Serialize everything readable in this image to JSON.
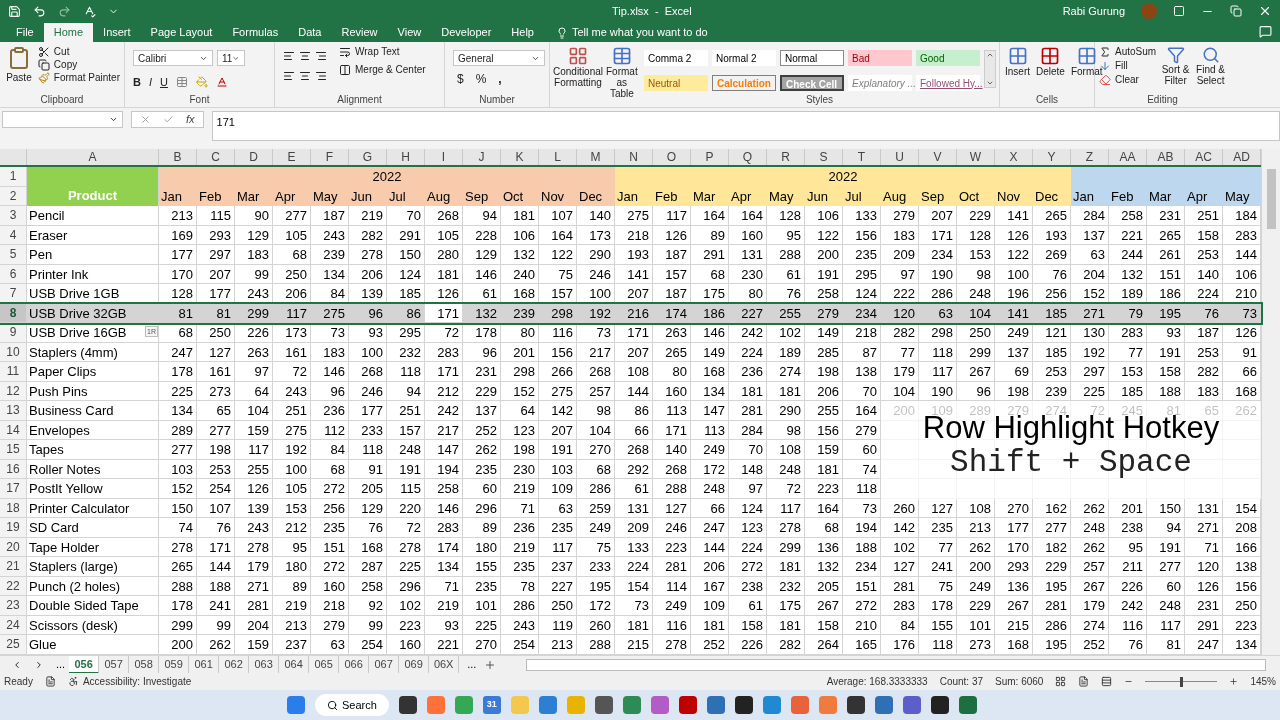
{
  "title_bar": {
    "file_title": "Tip.xlsx  -  Excel",
    "user": "Rabi Gurung"
  },
  "ribbon_tabs": [
    {
      "label": "File",
      "selected": false
    },
    {
      "label": "Home",
      "selected": true
    },
    {
      "label": "Insert",
      "selected": false
    },
    {
      "label": "Page Layout",
      "selected": false
    },
    {
      "label": "Formulas",
      "selected": false
    },
    {
      "label": "Data",
      "selected": false
    },
    {
      "label": "Review",
      "selected": false
    },
    {
      "label": "View",
      "selected": false
    },
    {
      "label": "Developer",
      "selected": false
    },
    {
      "label": "Help",
      "selected": false
    }
  ],
  "tell_me": "Tell me what you want to do",
  "ribbon": {
    "clipboard": {
      "label": "Clipboard",
      "paste": "Paste",
      "cut": "Cut",
      "copy": "Copy",
      "format_painter": "Format Painter"
    },
    "font": {
      "label": "Font",
      "name": "Calibri",
      "size": "11",
      "bold": "B",
      "italic": "I",
      "underline": "U"
    },
    "alignment": {
      "label": "Alignment",
      "wrap": "Wrap Text",
      "merge": "Merge & Center"
    },
    "number": {
      "label": "Number",
      "format": "General",
      "currency": "$",
      "percent": "%",
      "comma": ","
    },
    "conditional_formatting": "Conditional Formatting",
    "format_as_table": "Format as Table",
    "styles": {
      "label": "Styles",
      "cells": [
        {
          "label": "Comma 2",
          "kind": "plain"
        },
        {
          "label": "Normal 2",
          "kind": "plain"
        },
        {
          "label": "Normal",
          "kind": "normal"
        },
        {
          "label": "Bad",
          "kind": "bad"
        },
        {
          "label": "Good",
          "kind": "good"
        },
        {
          "label": "Neutral",
          "kind": "neutral"
        },
        {
          "label": "Calculation",
          "kind": "calculation"
        },
        {
          "label": "Check Cell",
          "kind": "check"
        },
        {
          "label": "Explanatory ...",
          "kind": "explanatory"
        },
        {
          "label": "Followed Hy...",
          "kind": "followed"
        }
      ]
    },
    "cells": {
      "label": "Cells",
      "buttons": [
        "Insert",
        "Delete",
        "Format"
      ]
    },
    "editing": {
      "label": "Editing",
      "autosum": "AutoSum",
      "fill": "Fill",
      "clear": "Clear",
      "sort": "Sort & Filter",
      "find": "Find & Select"
    }
  },
  "formula_bar": {
    "function_label": "fx",
    "value": "171"
  },
  "grid": {
    "columns": [
      "A",
      "B",
      "C",
      "D",
      "E",
      "F",
      "G",
      "H",
      "I",
      "J",
      "K",
      "L",
      "M",
      "N",
      "O",
      "P",
      "Q",
      "R",
      "S",
      "T",
      "U",
      "V",
      "W",
      "X",
      "Y",
      "Z",
      "AA",
      "AB",
      "AC",
      "AD"
    ],
    "header_label": "Product",
    "groups": [
      {
        "year": "2022",
        "color": "#f8cbad",
        "months": [
          "Jan",
          "Feb",
          "Mar",
          "Apr",
          "May",
          "Jun",
          "Jul",
          "Aug",
          "Sep",
          "Oct",
          "Nov",
          "Dec"
        ]
      },
      {
        "year": "2022",
        "color": "#ffe699",
        "months": [
          "Jan",
          "Feb",
          "Mar",
          "Apr",
          "May",
          "Jun",
          "Jul",
          "Aug",
          "Sep",
          "Oct",
          "Nov",
          "Dec"
        ]
      },
      {
        "color": "#bdd7ee",
        "months": [
          "Jan",
          "Feb",
          "Mar",
          "Apr",
          "May"
        ]
      }
    ],
    "header_rows": [
      "1",
      "2"
    ],
    "row_tip": "1R",
    "rows": [
      {
        "n": "3",
        "product": "Pencil",
        "selected": false,
        "values": [
          "213",
          "115",
          "90",
          "277",
          "187",
          "219",
          "70",
          "268",
          "94",
          "181",
          "107",
          "140",
          "275",
          "117",
          "164",
          "164",
          "128",
          "106",
          "133",
          "279",
          "207",
          "229",
          "141",
          "265",
          "284",
          "258",
          "231",
          "251",
          "184"
        ]
      },
      {
        "n": "4",
        "product": "Eraser",
        "selected": false,
        "values": [
          "169",
          "293",
          "129",
          "105",
          "243",
          "282",
          "291",
          "105",
          "228",
          "106",
          "164",
          "173",
          "218",
          "126",
          "89",
          "160",
          "95",
          "122",
          "156",
          "183",
          "171",
          "128",
          "126",
          "193",
          "137",
          "221",
          "265",
          "158",
          "283"
        ]
      },
      {
        "n": "5",
        "product": "Pen",
        "selected": false,
        "values": [
          "177",
          "297",
          "183",
          "68",
          "239",
          "278",
          "150",
          "280",
          "129",
          "132",
          "122",
          "290",
          "193",
          "187",
          "291",
          "131",
          "288",
          "200",
          "235",
          "209",
          "234",
          "153",
          "122",
          "269",
          "63",
          "244",
          "261",
          "253",
          "144"
        ]
      },
      {
        "n": "6",
        "product": "Printer Ink",
        "selected": false,
        "values": [
          "170",
          "207",
          "99",
          "250",
          "134",
          "206",
          "124",
          "181",
          "146",
          "240",
          "75",
          "246",
          "141",
          "157",
          "68",
          "230",
          "61",
          "191",
          "295",
          "97",
          "190",
          "98",
          "100",
          "76",
          "204",
          "132",
          "151",
          "140",
          "106"
        ]
      },
      {
        "n": "7",
        "product": "USB Drive 1GB",
        "selected": false,
        "values": [
          "128",
          "177",
          "243",
          "206",
          "84",
          "139",
          "185",
          "126",
          "61",
          "168",
          "157",
          "100",
          "207",
          "187",
          "175",
          "80",
          "76",
          "258",
          "124",
          "222",
          "286",
          "248",
          "196",
          "256",
          "152",
          "189",
          "186",
          "224",
          "210"
        ]
      },
      {
        "n": "8",
        "product": "USB Drive 32GB",
        "selected": true,
        "values": [
          "81",
          "81",
          "299",
          "117",
          "275",
          "96",
          "86",
          {
            "value": "171",
            "active": true
          },
          "132",
          "239",
          "298",
          "192",
          "216",
          "174",
          "186",
          "227",
          "255",
          "279",
          "234",
          "120",
          "63",
          "104",
          "141",
          "185",
          "271",
          "79",
          "195",
          "76",
          "73"
        ]
      },
      {
        "n": "9",
        "product": "USB Drive 16GB",
        "selected": false,
        "values": [
          "68",
          "250",
          "226",
          "173",
          "73",
          "93",
          "295",
          "72",
          "178",
          "80",
          "116",
          "73",
          "171",
          "263",
          "146",
          "242",
          "102",
          "149",
          "218",
          "282",
          "298",
          "250",
          "249",
          "121",
          "130",
          "283",
          "93",
          "187",
          "126"
        ]
      },
      {
        "n": "10",
        "product": "Staplers (4mm)",
        "selected": false,
        "values": [
          "247",
          "127",
          "263",
          "161",
          "183",
          "100",
          "232",
          "283",
          "96",
          "201",
          "156",
          "217",
          "207",
          "265",
          "149",
          "224",
          "189",
          "285",
          "87",
          "77",
          "118",
          "299",
          "137",
          "185",
          "192",
          "77",
          "191",
          "253",
          "91"
        ]
      },
      {
        "n": "11",
        "product": "Paper Clips",
        "selected": false,
        "values": [
          "178",
          "161",
          "97",
          "72",
          "146",
          "268",
          "118",
          "171",
          "231",
          "298",
          "266",
          "268",
          "108",
          "80",
          "168",
          "236",
          "274",
          "198",
          "138",
          "179",
          "117",
          "267",
          "69",
          "253",
          "297",
          "153",
          "158",
          "282",
          "66"
        ]
      },
      {
        "n": "12",
        "product": "Push Pins",
        "selected": false,
        "values": [
          "225",
          "273",
          "64",
          "243",
          "96",
          "246",
          "94",
          "212",
          "229",
          "152",
          "275",
          "257",
          "144",
          "160",
          "134",
          "181",
          "181",
          "206",
          "70",
          "104",
          "190",
          "96",
          "198",
          "239",
          "225",
          "185",
          "188",
          "183",
          "168"
        ]
      },
      {
        "n": "13",
        "product": "Business Card",
        "selected": false,
        "values": [
          "134",
          "65",
          "104",
          "251",
          "236",
          "177",
          "251",
          "242",
          "137",
          "64",
          "142",
          "98",
          "86",
          "113",
          "147",
          "281",
          "290",
          "255",
          "164",
          "200",
          "109",
          "289",
          "279",
          "274",
          "72",
          "245",
          "81",
          "65",
          "262"
        ]
      },
      {
        "n": "14",
        "product": "Envelopes",
        "selected": false,
        "values": [
          "289",
          "277",
          "159",
          "275",
          "112",
          "233",
          "157",
          "217",
          "252",
          "123",
          "207",
          "104",
          "66",
          "171",
          "113",
          "284",
          "98",
          "156",
          "279"
        ]
      },
      {
        "n": "15",
        "product": "Tapes",
        "selected": false,
        "values": [
          "277",
          "198",
          "117",
          "192",
          "84",
          "118",
          "248",
          "147",
          "262",
          "198",
          "191",
          "270",
          "268",
          "140",
          "249",
          "70",
          "108",
          "159",
          "60"
        ]
      },
      {
        "n": "16",
        "product": "Roller Notes",
        "selected": false,
        "values": [
          "103",
          "253",
          "255",
          "100",
          "68",
          "91",
          "191",
          "194",
          "235",
          "230",
          "103",
          "68",
          "292",
          "268",
          "172",
          "148",
          "248",
          "181",
          "74"
        ]
      },
      {
        "n": "17",
        "product": "PostIt Yellow",
        "selected": false,
        "values": [
          "152",
          "254",
          "126",
          "105",
          "272",
          "205",
          "115",
          "258",
          "60",
          "219",
          "109",
          "286",
          "61",
          "288",
          "248",
          "97",
          "72",
          "223",
          "118"
        ]
      },
      {
        "n": "18",
        "product": "Printer Calculator",
        "selected": false,
        "values": [
          "150",
          "107",
          "139",
          "153",
          "256",
          "129",
          "220",
          "146",
          "296",
          "71",
          "63",
          "259",
          "131",
          "127",
          "66",
          "124",
          "117",
          "164",
          "73",
          "260",
          "127",
          "108",
          "270",
          "162",
          "262",
          "201",
          "150",
          "131",
          "154"
        ]
      },
      {
        "n": "19",
        "product": "SD Card",
        "selected": false,
        "values": [
          "74",
          "76",
          "243",
          "212",
          "235",
          "76",
          "72",
          "283",
          "89",
          "236",
          "235",
          "249",
          "209",
          "246",
          "247",
          "123",
          "278",
          "68",
          "194",
          "142",
          "235",
          "213",
          "177",
          "277",
          "248",
          "238",
          "94",
          "271",
          "208"
        ]
      },
      {
        "n": "20",
        "product": "Tape Holder",
        "selected": false,
        "values": [
          "278",
          "171",
          "278",
          "95",
          "151",
          "168",
          "278",
          "174",
          "180",
          "219",
          "117",
          "75",
          "133",
          "223",
          "144",
          "224",
          "299",
          "136",
          "188",
          "102",
          "77",
          "262",
          "170",
          "182",
          "262",
          "95",
          "191",
          "71",
          "166"
        ]
      },
      {
        "n": "21",
        "product": "Staplers (large)",
        "selected": false,
        "values": [
          "265",
          "144",
          "179",
          "180",
          "272",
          "287",
          "225",
          "134",
          "155",
          "235",
          "237",
          "233",
          "224",
          "281",
          "206",
          "272",
          "181",
          "132",
          "234",
          "127",
          "241",
          "200",
          "293",
          "229",
          "257",
          "211",
          "277",
          "120",
          "138"
        ]
      },
      {
        "n": "22",
        "product": "Punch (2 holes)",
        "selected": false,
        "values": [
          "288",
          "188",
          "271",
          "89",
          "160",
          "258",
          "296",
          "71",
          "235",
          "78",
          "227",
          "195",
          "154",
          "114",
          "167",
          "238",
          "232",
          "205",
          "151",
          "281",
          "75",
          "249",
          "136",
          "195",
          "267",
          "226",
          "60",
          "126",
          "156"
        ]
      },
      {
        "n": "23",
        "product": "Double Sided Tape",
        "selected": false,
        "values": [
          "178",
          "241",
          "281",
          "219",
          "218",
          "92",
          "102",
          "219",
          "101",
          "286",
          "250",
          "172",
          "73",
          "249",
          "109",
          "61",
          "175",
          "267",
          "272",
          "283",
          "178",
          "229",
          "267",
          "281",
          "179",
          "242",
          "248",
          "231",
          "250"
        ]
      },
      {
        "n": "24",
        "product": "Scissors (desk)",
        "selected": false,
        "values": [
          "299",
          "99",
          "204",
          "213",
          "279",
          "99",
          "223",
          "93",
          "225",
          "243",
          "119",
          "260",
          "181",
          "116",
          "181",
          "158",
          "181",
          "158",
          "210",
          "84",
          "155",
          "101",
          "215",
          "286",
          "274",
          "116",
          "117",
          "291",
          "223"
        ]
      },
      {
        "n": "25",
        "product": "Glue",
        "selected": false,
        "values": [
          "200",
          "262",
          "159",
          "237",
          "63",
          "254",
          "160",
          "221",
          "270",
          "254",
          "213",
          "288",
          "215",
          "278",
          "252",
          "226",
          "282",
          "264",
          "165",
          "176",
          "118",
          "273",
          "168",
          "195",
          "252",
          "76",
          "81",
          "247",
          "134"
        ]
      }
    ]
  },
  "overlay": {
    "title": "Row Highlight Hotkey",
    "hotkey": "Shift + Space"
  },
  "sheet_tabs": [
    {
      "label": "056",
      "selected": true
    },
    {
      "label": "057",
      "selected": false
    },
    {
      "label": "058",
      "selected": false
    },
    {
      "label": "059",
      "selected": false
    },
    {
      "label": "061",
      "selected": false
    },
    {
      "label": "062",
      "selected": false
    },
    {
      "label": "063",
      "selected": false
    },
    {
      "label": "064",
      "selected": false
    },
    {
      "label": "065",
      "selected": false
    },
    {
      "label": "066",
      "selected": false
    },
    {
      "label": "067",
      "selected": false
    },
    {
      "label": "069",
      "selected": false
    },
    {
      "label": "06X",
      "selected": false
    }
  ],
  "sheet_more": "...",
  "status_bar": {
    "mode": "Ready",
    "accessibility": "Accessibility: Investigate",
    "average": "Average: 168.3333333",
    "count": "Count: 37",
    "sum": "Sum: 6060",
    "zoom": "145%",
    "zoom_slider": {
      "level": 0.5
    }
  },
  "taskbar": {
    "search": "Search",
    "calendar_day": "31"
  }
}
